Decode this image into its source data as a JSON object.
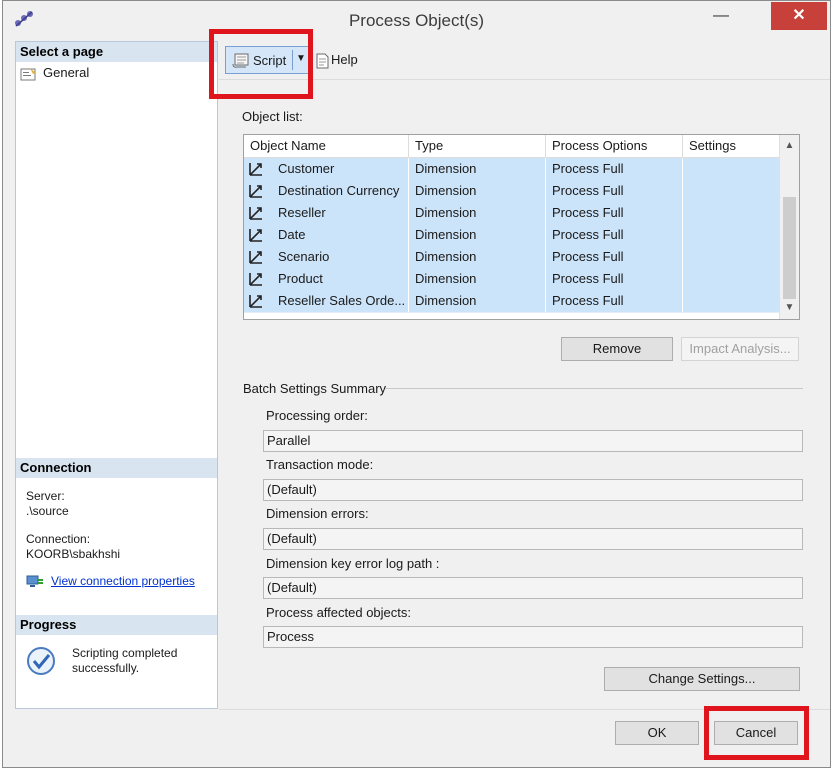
{
  "window": {
    "title": "Process Object(s)"
  },
  "left_pane": {
    "select_page_header": "Select a page",
    "pages": [
      {
        "label": "General"
      }
    ],
    "connection_header": "Connection",
    "server_label": "Server:",
    "server_value": ".\\source",
    "connection_label": "Connection:",
    "connection_value": "KOORB\\sbakhshi",
    "view_connection_link": "View connection properties",
    "progress_header": "Progress",
    "progress_status": "Scripting completed successfully."
  },
  "toolbar": {
    "script_label": "Script",
    "help_label": "Help"
  },
  "object_list": {
    "label": "Object list:",
    "columns": [
      "Object Name",
      "Type",
      "Process Options",
      "Settings"
    ],
    "rows": [
      {
        "name": "Customer",
        "type": "Dimension",
        "process_options": "Process Full",
        "settings": ""
      },
      {
        "name": "Destination Currency",
        "type": "Dimension",
        "process_options": "Process Full",
        "settings": ""
      },
      {
        "name": "Reseller",
        "type": "Dimension",
        "process_options": "Process Full",
        "settings": ""
      },
      {
        "name": "Date",
        "type": "Dimension",
        "process_options": "Process Full",
        "settings": ""
      },
      {
        "name": "Scenario",
        "type": "Dimension",
        "process_options": "Process Full",
        "settings": ""
      },
      {
        "name": "Product",
        "type": "Dimension",
        "process_options": "Process Full",
        "settings": ""
      },
      {
        "name": "Reseller Sales Orde...",
        "type": "Dimension",
        "process_options": "Process Full",
        "settings": ""
      }
    ],
    "remove_label": "Remove",
    "impact_label": "Impact Analysis..."
  },
  "batch": {
    "title": "Batch Settings Summary",
    "fields": [
      {
        "label": "Processing order:",
        "value": "Parallel"
      },
      {
        "label": "Transaction mode:",
        "value": "(Default)"
      },
      {
        "label": "Dimension errors:",
        "value": "(Default)"
      },
      {
        "label": "Dimension key error log path :",
        "value": "(Default)"
      },
      {
        "label": "Process affected objects:",
        "value": "Process"
      }
    ],
    "change_settings_label": "Change Settings..."
  },
  "footer": {
    "ok_label": "OK",
    "cancel_label": "Cancel"
  },
  "colors": {
    "selection": "#cce4fa",
    "highlight_box": "#e0141c",
    "header_band": "#d8e4f0",
    "close_button": "#c7403a"
  }
}
